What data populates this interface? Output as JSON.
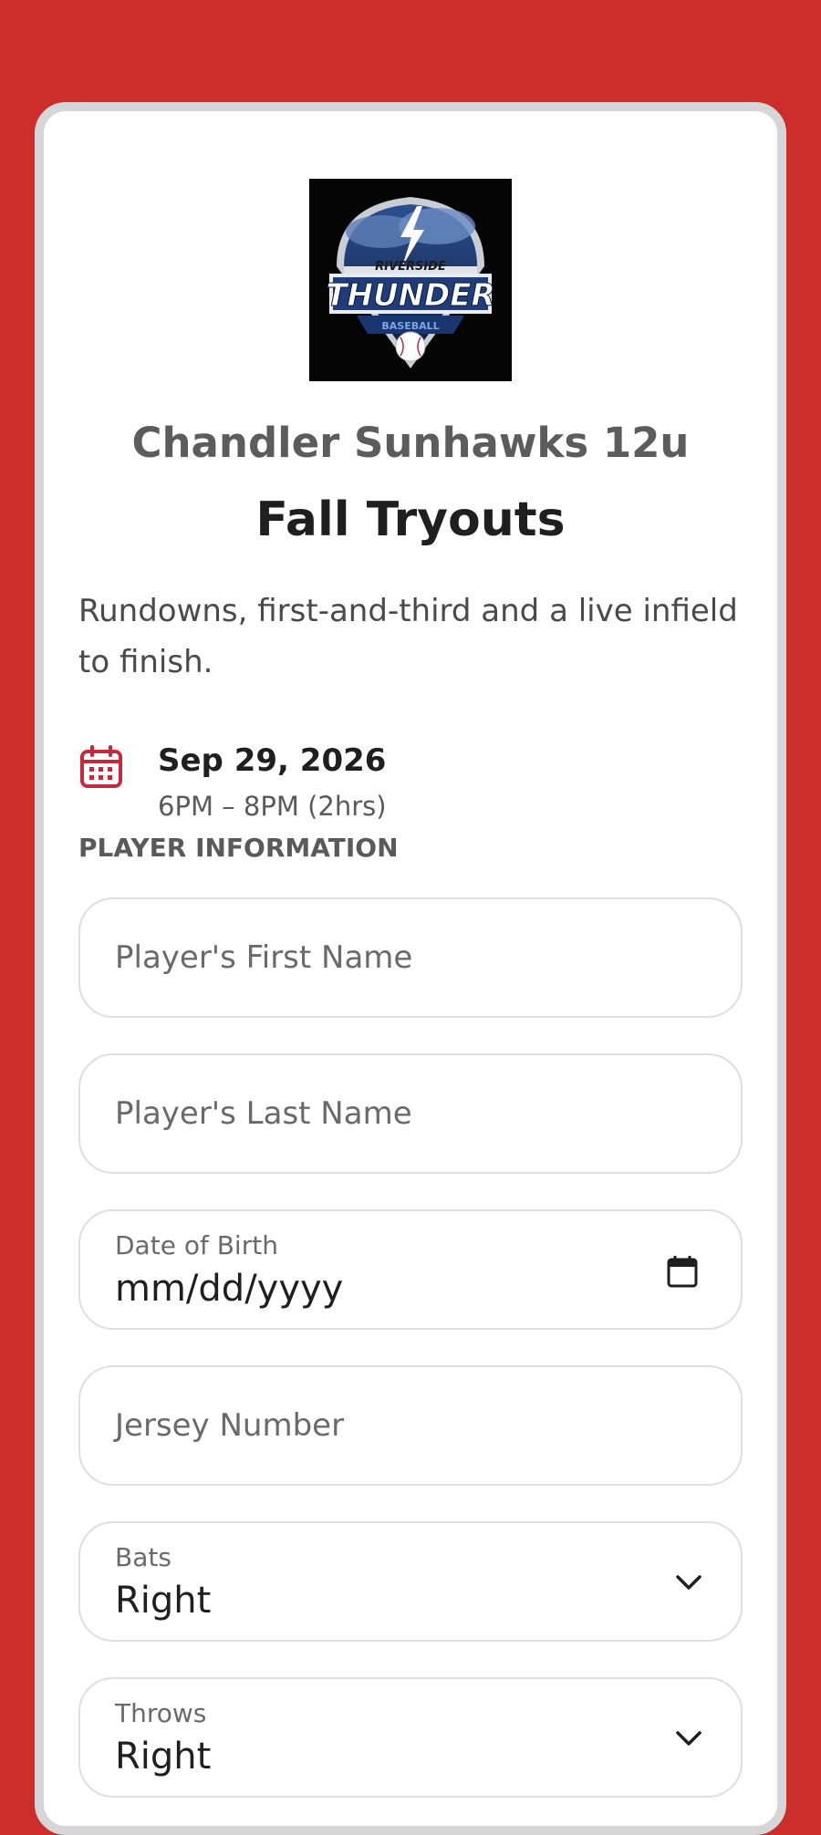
{
  "header": {
    "logo_top_text": "RIVERSIDE",
    "logo_main_text": "THUNDER",
    "logo_bottom_text": "BASEBALL",
    "team_name": "Chandler Sunhawks 12u",
    "event_title": "Fall Tryouts",
    "description": "Rundowns, first-and-third and a live infield to finish."
  },
  "event": {
    "date": "Sep 29, 2026",
    "time": "6PM – 8PM (2hrs)",
    "icon": "calendar-icon"
  },
  "form": {
    "section_label": "PLAYER INFORMATION",
    "first_name_placeholder": "Player's First Name",
    "last_name_placeholder": "Player's Last Name",
    "dob_label": "Date of Birth",
    "dob_value": "mm/dd/yyyy",
    "jersey_placeholder": "Jersey Number",
    "bats_label": "Bats",
    "bats_value": "Right",
    "throws_label": "Throws",
    "throws_value": "Right"
  },
  "colors": {
    "background": "#cc2e2c",
    "accent": "#c42a3c",
    "card": "#ffffff"
  }
}
